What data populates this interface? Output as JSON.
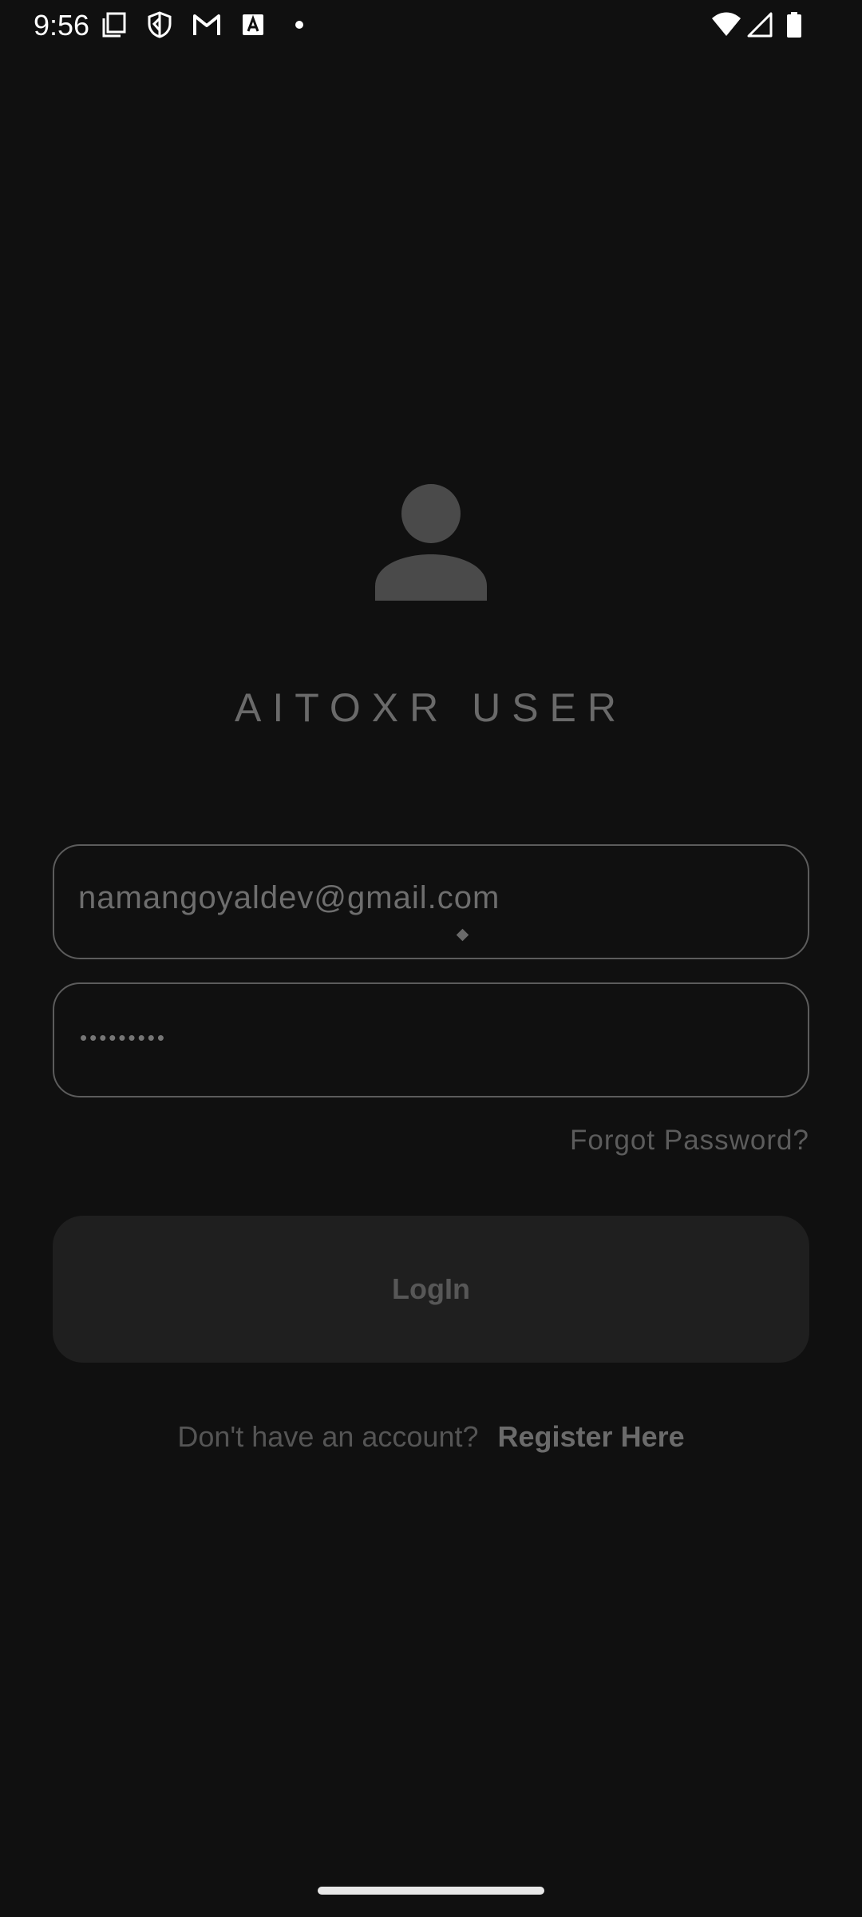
{
  "status_bar": {
    "time": "9:56",
    "left_icons": [
      "screenshot-icon",
      "shield-icon",
      "gmail-icon",
      "app-a-icon",
      "dot-icon"
    ],
    "right_icons": [
      "wifi-icon",
      "signal-icon",
      "battery-icon"
    ]
  },
  "profile": {
    "avatar_icon": "person-icon",
    "title": "AITOXR USER"
  },
  "form": {
    "email_value": "namangoyaldev@gmail.com",
    "password_masked": "•••••••••",
    "forgot_password_label": "Forgot Password?",
    "login_label": "LogIn",
    "register_prompt": "Don't have an account?",
    "register_link": "Register Here"
  },
  "colors": {
    "background": "#101010",
    "field_border": "#5c5c5c",
    "button_background": "#1f1f1f"
  }
}
